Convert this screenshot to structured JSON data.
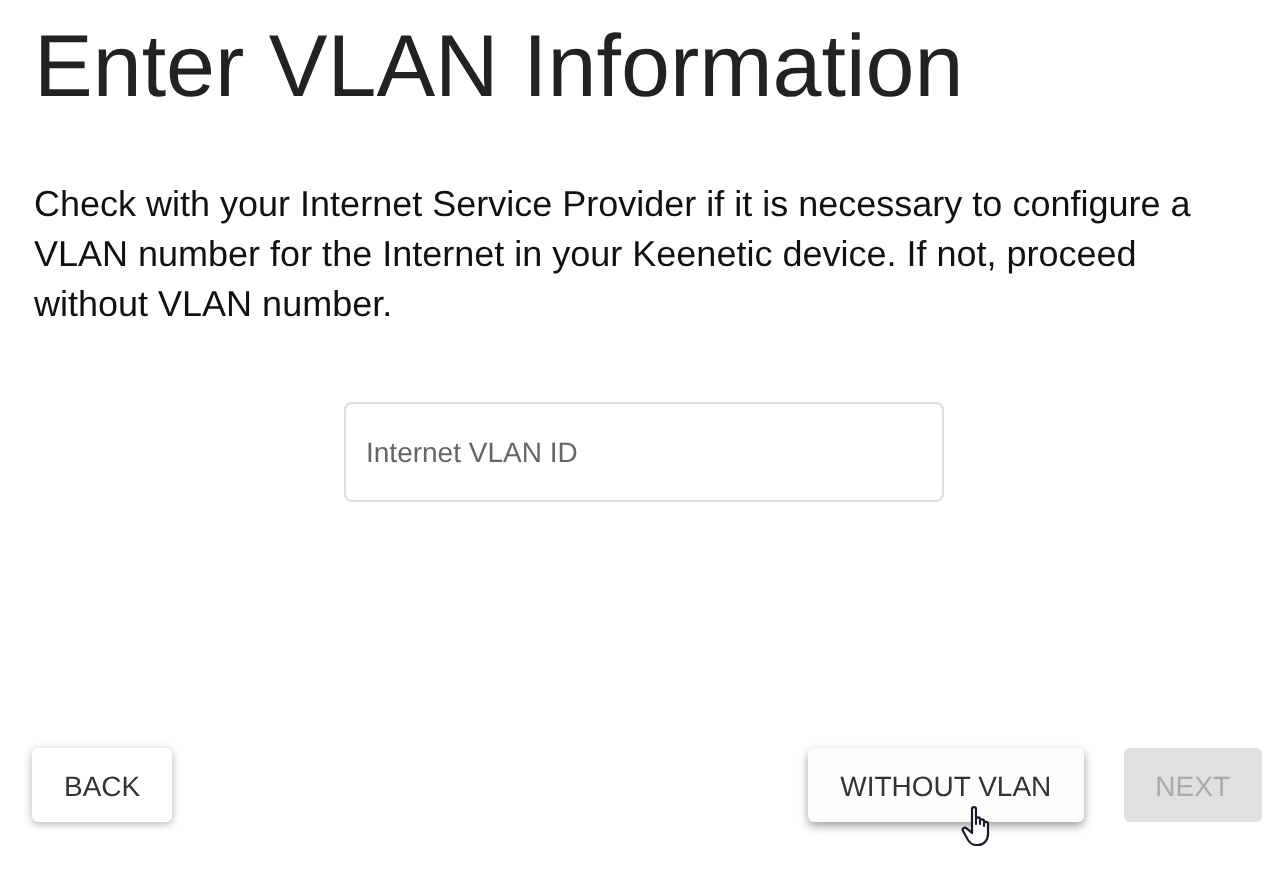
{
  "title": "Enter VLAN Information",
  "description": "Check with your Internet Service Provider if it is necessary to configure a VLAN number for the Internet in your Keenetic device. If not, proceed without VLAN number.",
  "vlan_field": {
    "placeholder": "Internet VLAN ID"
  },
  "buttons": [
    {
      "label": "BACK",
      "disabled": false,
      "hovered": false
    },
    {
      "label": "WITHOUT VLAN",
      "disabled": false,
      "hovered": true
    },
    {
      "label": "NEXT",
      "disabled": true,
      "hovered": false
    }
  ]
}
